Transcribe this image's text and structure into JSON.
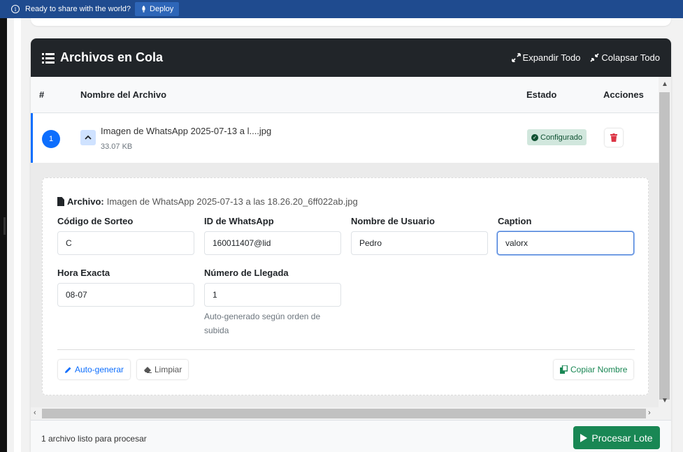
{
  "topbar": {
    "message": "Ready to share with the world?",
    "deploy_label": "Deploy"
  },
  "card": {
    "title": "Archivos en Cola",
    "expand_label": "Expandir Todo",
    "collapse_label": "Colapsar Todo"
  },
  "table": {
    "headers": {
      "num": "#",
      "name": "Nombre del Archivo",
      "status": "Estado",
      "actions": "Acciones"
    },
    "rows": [
      {
        "num": "1",
        "name": "Imagen de WhatsApp 2025-07-13 a l....jpg",
        "size": "33.07 KB",
        "status": "Configurado",
        "status_color": "#d1e7dd"
      }
    ]
  },
  "detail": {
    "file_label": "Archivo:",
    "file_name": "Imagen de WhatsApp 2025-07-13 a las 18.26.20_6ff022ab.jpg",
    "fields": {
      "codigo": {
        "label": "Código de Sorteo",
        "value": "C"
      },
      "whatsapp": {
        "label": "ID de WhatsApp",
        "value": "160011407@lid"
      },
      "usuario": {
        "label": "Nombre de Usuario",
        "value": "Pedro"
      },
      "caption": {
        "label": "Caption",
        "value": "valorx"
      },
      "hora": {
        "label": "Hora Exacta",
        "value": "08-07"
      },
      "llegada": {
        "label": "Número de Llegada",
        "value": "1",
        "help": "Auto-generado según orden de subida"
      }
    },
    "buttons": {
      "autogen": "Auto-generar",
      "clear": "Limpiar",
      "copy": "Copiar Nombre"
    }
  },
  "footer": {
    "status_text": "1 archivo listo para procesar",
    "process_label": "Procesar Lote"
  },
  "colors": {
    "primary": "#0d6efd",
    "success": "#198754",
    "danger": "#dc3545",
    "header_bg": "#212529"
  }
}
